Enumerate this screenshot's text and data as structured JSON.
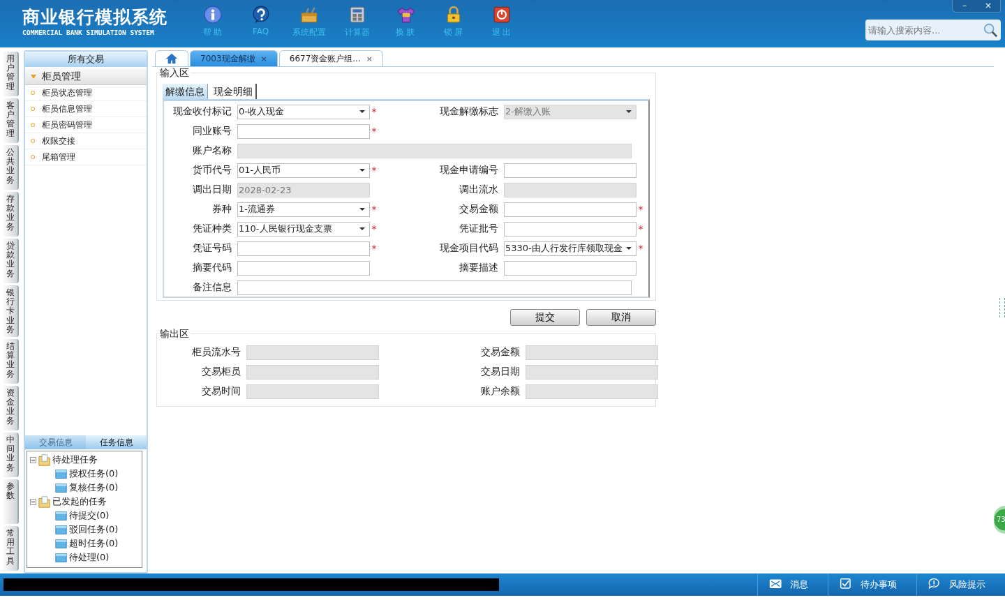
{
  "header": {
    "title": "商业银行模拟系统",
    "subtitle": "COMMERCIAL BANK SIMULATION SYSTEM",
    "nav": [
      {
        "label": "帮 助"
      },
      {
        "label": "FAQ"
      },
      {
        "label": "系统配置"
      },
      {
        "label": "计算器"
      },
      {
        "label": "换 肤"
      },
      {
        "label": "锁 屏"
      },
      {
        "label": "退 出"
      }
    ],
    "search": {
      "placeholder": "请输入搜索内容..."
    },
    "window_controls": [
      "–",
      "×"
    ]
  },
  "side_tabs": [
    "用户管理",
    "客户管理",
    "公共业务",
    "存款业务",
    "贷款业务",
    "银行卡业务",
    "结算业务",
    "资金业务",
    "中间业务",
    "参数",
    "常用工具"
  ],
  "sidebar": {
    "title": "所有交易",
    "group": {
      "label": "柜员管理",
      "expanded": true
    },
    "items": [
      "柜员状态管理",
      "柜员信息管理",
      "柜员密码管理",
      "权限交接",
      "尾箱管理"
    ]
  },
  "bottom_panel": {
    "tabs": [
      {
        "label": "交易信息",
        "selected": false
      },
      {
        "label": "任务信息",
        "selected": true
      }
    ],
    "tree": [
      {
        "label": "待处理任务",
        "expanded": true,
        "children": [
          {
            "label": "授权任务(0)"
          },
          {
            "label": "复核任务(0)"
          }
        ]
      },
      {
        "label": "已发起的任务",
        "expanded": true,
        "children": [
          {
            "label": "待提交(0)"
          },
          {
            "label": "驳回任务(0)"
          },
          {
            "label": "超时任务(0)"
          },
          {
            "label": "待处理(0)"
          }
        ]
      }
    ]
  },
  "tabs": [
    {
      "kind": "home",
      "selected": false
    },
    {
      "kind": "page",
      "label": "7003现金解缴",
      "close": "×",
      "selected": true
    },
    {
      "kind": "page",
      "label": "6677资金账户组...",
      "close": "×",
      "selected": false
    }
  ],
  "input_area": {
    "title": "输入区",
    "tabs": [
      {
        "label": "解缴信息",
        "selected": true
      },
      {
        "label": "现金明细",
        "selected": false
      }
    ],
    "fields": [
      {
        "label": "现金收付标记",
        "kind": "select",
        "value": "0-收入现金",
        "disabled": false,
        "required": true
      },
      {
        "label": "现金解缴标志",
        "kind": "select",
        "value": "2-解缴入账",
        "disabled": true,
        "required": false
      },
      {
        "label": "同业账号",
        "kind": "text",
        "disabled": false,
        "required": true
      },
      {
        "kind": "blank"
      },
      {
        "label": "账户名称",
        "kind": "text",
        "disabled": true,
        "required": false,
        "wide": true
      },
      {
        "label": "货币代号",
        "kind": "select",
        "value": "01-人民币",
        "disabled": false,
        "required": true
      },
      {
        "label": "现金申请编号",
        "kind": "text",
        "disabled": false,
        "required": false
      },
      {
        "label": "调出日期",
        "kind": "text",
        "value": "2028-02-23",
        "disabled": true,
        "required": false
      },
      {
        "label": "调出流水",
        "kind": "text",
        "disabled": true,
        "required": false
      },
      {
        "label": "券种",
        "kind": "select",
        "value": "1-流通券",
        "disabled": false,
        "required": true
      },
      {
        "label": "交易金额",
        "kind": "text",
        "disabled": false,
        "required": true
      },
      {
        "label": "凭证种类",
        "kind": "select",
        "value": "110-人民银行现金支票",
        "disabled": false,
        "required": true
      },
      {
        "label": "凭证批号",
        "kind": "text",
        "disabled": false,
        "required": true
      },
      {
        "label": "凭证号码",
        "kind": "text",
        "disabled": false,
        "required": true
      },
      {
        "label": "现金项目代码",
        "kind": "select",
        "value": "5330-由人行发行库领取现金",
        "disabled": false,
        "required": true
      },
      {
        "label": "摘要代码",
        "kind": "text",
        "disabled": false,
        "required": false
      },
      {
        "label": "摘要描述",
        "kind": "text",
        "disabled": false,
        "required": false
      },
      {
        "label": "备注信息",
        "kind": "text",
        "disabled": false,
        "required": false,
        "wide": true
      }
    ],
    "required_mark": "*"
  },
  "buttons": [
    "提交",
    "取消"
  ],
  "output_area": {
    "title": "输出区",
    "fields": [
      {
        "label": "柜员流水号",
        "disabled": true
      },
      {
        "label": "交易金额",
        "disabled": true
      },
      {
        "label": "交易柜员",
        "disabled": true
      },
      {
        "label": "交易日期",
        "disabled": true
      },
      {
        "label": "交易时间",
        "disabled": true
      },
      {
        "label": "账户余额",
        "disabled": true
      }
    ]
  },
  "floating_badge": "73",
  "status_bar": {
    "items": [
      {
        "label": "消息"
      },
      {
        "label": "待办事项"
      },
      {
        "label": "风险提示"
      }
    ]
  }
}
